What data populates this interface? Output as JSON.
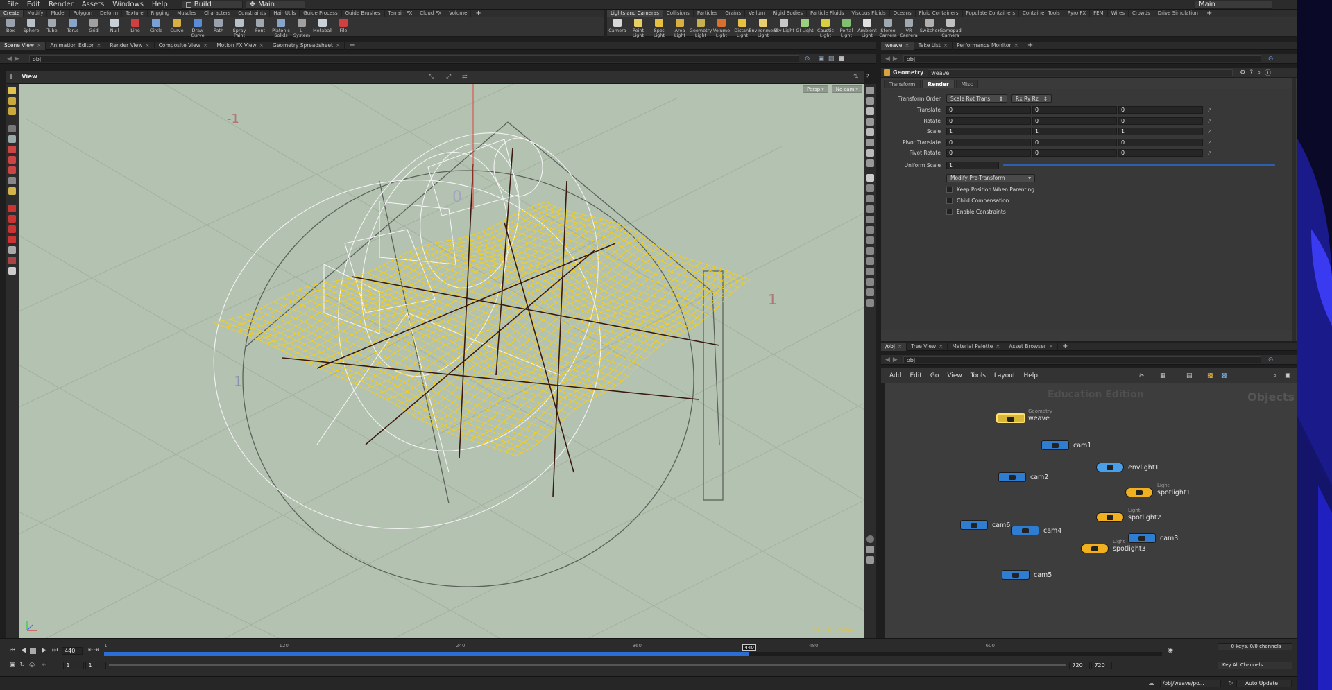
{
  "menubar": {
    "items": [
      "File",
      "Edit",
      "Render",
      "Assets",
      "Windows",
      "Help"
    ],
    "desktop": "Build",
    "context": "Main",
    "right_context": "Main"
  },
  "shelf_left": {
    "tabs": [
      "Create",
      "Modify",
      "Model",
      "Polygon",
      "Deform",
      "Texture",
      "Rigging",
      "Muscles",
      "Characters",
      "Constraints",
      "Hair Utils",
      "Guide Process",
      "Guide Brushes",
      "Terrain FX",
      "Cloud FX",
      "Volume"
    ],
    "tools": [
      "Box",
      "Sphere",
      "Tube",
      "Torus",
      "Grid",
      "Null",
      "Line",
      "Circle",
      "Curve",
      "Draw Curve",
      "Path",
      "Spray Paint",
      "Font",
      "Platonic Solids",
      "L-System",
      "Metaball",
      "File"
    ]
  },
  "shelf_right": {
    "tabs": [
      "Lights and Cameras",
      "Collisions",
      "Particles",
      "Grains",
      "Vellum",
      "Rigid Bodies",
      "Particle Fluids",
      "Viscous Fluids",
      "Oceans",
      "Fluid Containers",
      "Populate Containers",
      "Container Tools",
      "Pyro FX",
      "FEM",
      "Wires",
      "Crowds",
      "Drive Simulation"
    ],
    "tools": [
      "Camera",
      "Point Light",
      "Spot Light",
      "Area Light",
      "Geometry Light",
      "Volume Light",
      "Distant Light",
      "Environment Light",
      "Sky Light",
      "GI Light",
      "Caustic Light",
      "Portal Light",
      "Ambient Light",
      "Stereo Camera",
      "VR Camera",
      "Switcher",
      "Gamepad Camera"
    ]
  },
  "left_panetabs": [
    "Scene View",
    "Animation Editor",
    "Render View",
    "Composite View",
    "Motion FX View",
    "Geometry Spreadsheet"
  ],
  "right_panetabs": [
    "weave",
    "Take List",
    "Performance Monitor"
  ],
  "net_panetabs": [
    "/obj",
    "Tree View",
    "Material Palette",
    "Asset Browser"
  ],
  "paths": {
    "left": "obj",
    "param": "obj",
    "net": "obj"
  },
  "view": {
    "title": "View",
    "persp": "Persp",
    "cam": "No cam",
    "watermark": "Education Edition",
    "grid_labels": [
      "-1",
      "0",
      "1",
      "1"
    ]
  },
  "params": {
    "node_type": "Geometry",
    "node_name": "weave",
    "tabs": [
      "Transform",
      "Render",
      "Misc"
    ],
    "active_tab": "Render",
    "transform_order_label": "Transform Order",
    "transform_order": "Scale Rot Trans",
    "rotate_order": "Rx Ry Rz",
    "rows": [
      {
        "label": "Translate",
        "values": [
          "0",
          "0",
          "0"
        ]
      },
      {
        "label": "Rotate",
        "values": [
          "0",
          "0",
          "0"
        ]
      },
      {
        "label": "Scale",
        "values": [
          "1",
          "1",
          "1"
        ]
      },
      {
        "label": "Pivot Translate",
        "values": [
          "0",
          "0",
          "0"
        ]
      },
      {
        "label": "Pivot Rotate",
        "values": [
          "0",
          "0",
          "0"
        ]
      }
    ],
    "uniform_scale_label": "Uniform Scale",
    "uniform_scale": "1",
    "modify_button": "Modify Pre-Transform",
    "checkboxes": [
      "Keep Position When Parenting",
      "Child Compensation",
      "Enable Constraints"
    ]
  },
  "network": {
    "menu": [
      "Add",
      "Edit",
      "Go",
      "View",
      "Tools",
      "Layout",
      "Help"
    ],
    "edition": "Education Edition",
    "context_label": "Objects",
    "nodes": [
      {
        "name": "weave",
        "type": "Geometry",
        "kind": "geo"
      },
      {
        "name": "cam1",
        "type": "",
        "kind": "cam"
      },
      {
        "name": "envlight1",
        "type": "",
        "kind": "env"
      },
      {
        "name": "cam2",
        "type": "",
        "kind": "cam"
      },
      {
        "name": "spotlight1",
        "type": "Light",
        "kind": "light"
      },
      {
        "name": "spotlight2",
        "type": "Light",
        "kind": "light"
      },
      {
        "name": "cam6",
        "type": "",
        "kind": "cam"
      },
      {
        "name": "cam4",
        "type": "",
        "kind": "cam"
      },
      {
        "name": "cam3",
        "type": "",
        "kind": "cam"
      },
      {
        "name": "spotlight3",
        "type": "Light",
        "kind": "light"
      },
      {
        "name": "cam5",
        "type": "",
        "kind": "cam"
      }
    ]
  },
  "timeline": {
    "current_frame": "440",
    "start": "1",
    "start2": "1",
    "end": "720",
    "end2": "720",
    "ticks": [
      "1",
      "120",
      "240",
      "360",
      "480",
      "600"
    ],
    "marker": "440",
    "keys_info": "0 keys, 0/0 channels",
    "key_all": "Key All Channels",
    "playhead_fraction": 0.61
  },
  "status": {
    "path": "/obj/weave/po...",
    "update": "Auto Update"
  },
  "colors": {
    "viewport_bg": "#b4c2b1",
    "geometry": "#ffd200",
    "accent": "#2b6fd6"
  }
}
